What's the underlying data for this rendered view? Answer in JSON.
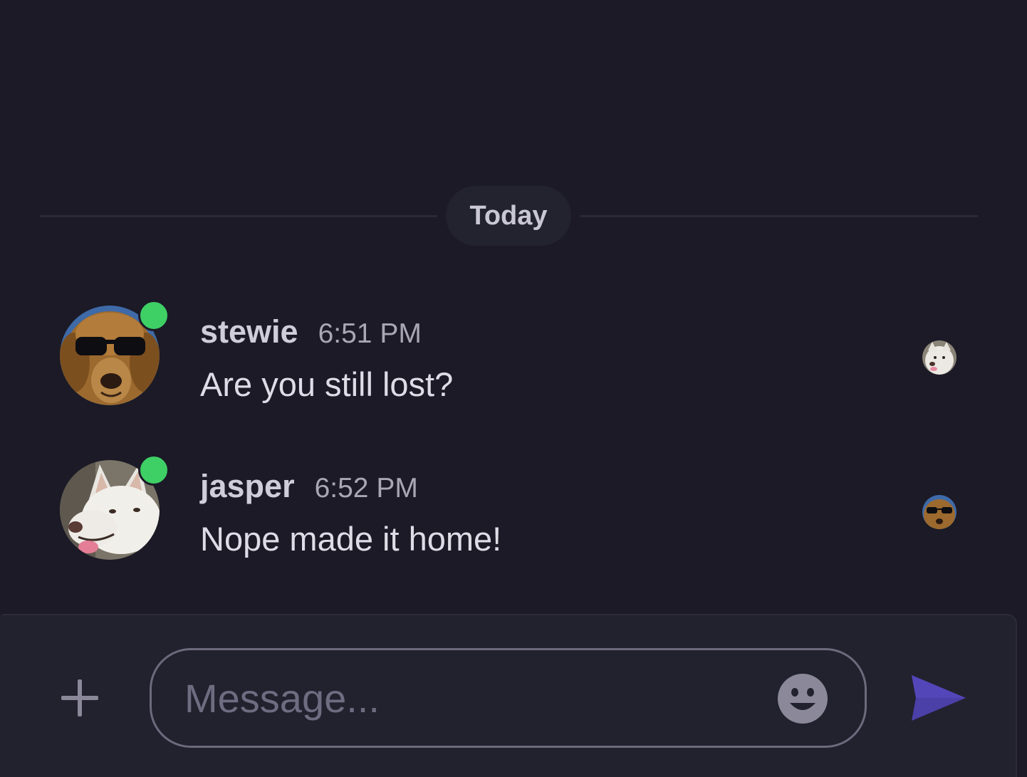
{
  "divider": {
    "label": "Today"
  },
  "messages": [
    {
      "author": "stewie",
      "time": "6:51 PM",
      "text": "Are you still lost?",
      "online": true,
      "avatar_icon": "golden-retriever-sunglasses-avatar",
      "read_receipt_icon": "white-husky-avatar"
    },
    {
      "author": "jasper",
      "time": "6:52 PM",
      "text": "Nope made it home!",
      "online": true,
      "avatar_icon": "white-husky-avatar",
      "read_receipt_icon": "golden-retriever-sunglasses-avatar"
    }
  ],
  "composer": {
    "placeholder": "Message...",
    "value": "",
    "add_icon": "plus-icon",
    "emoji_icon": "smiley-face-icon",
    "send_icon": "send-arrow-icon"
  },
  "colors": {
    "background": "#1b1a26",
    "online": "#3ecf65",
    "send_accent": "#4b3fa8",
    "muted_icon": "#8a8899"
  }
}
